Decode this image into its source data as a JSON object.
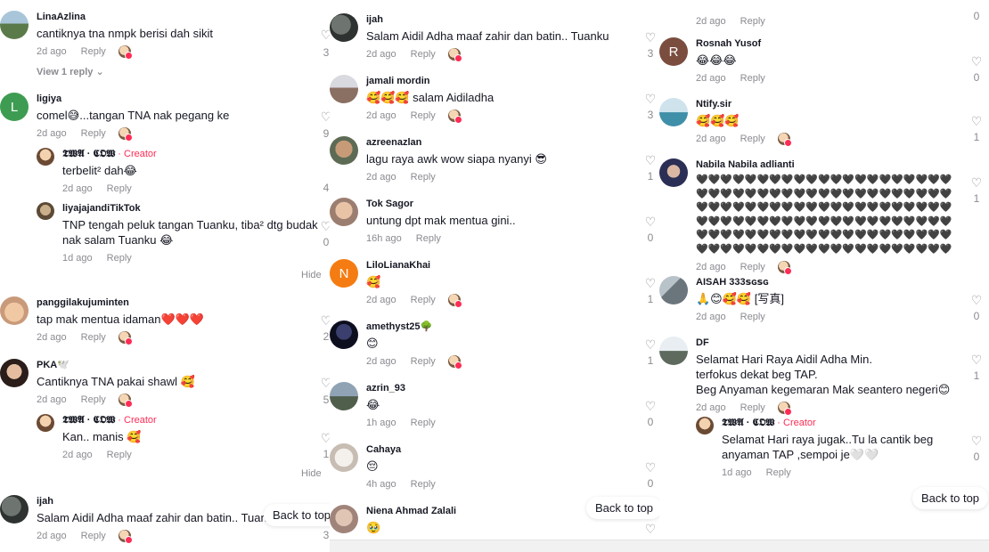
{
  "ui": {
    "reply_label": "Reply",
    "hide_label": "Hide",
    "view_reply_label": "View 1 reply",
    "back_to_top": "Back to top",
    "creator_label": "· Creator",
    "heart_icon": "heart-outline",
    "chevron_icon": "chevron-down",
    "colors": {
      "creator": "#fe2c55",
      "meta": "#8a8b91",
      "text": "#161823"
    }
  },
  "col1": {
    "c1": {
      "user": "LinaAzlina",
      "text": "cantiknya tna nmpk berisi dah sikit",
      "time": "2d ago",
      "likes": "3"
    },
    "c2": {
      "user": "ligiya",
      "avatar_letter": "L",
      "text": "comel😅...tangan TNA nak pegang ke",
      "time": "2d ago",
      "likes": "9"
    },
    "r2a": {
      "user": "𝕿𝖂𝕬 · 𝕮𝕺𝖂",
      "text": "terbelit² dah😂",
      "time": "2d ago"
    },
    "r2b": {
      "user": "liyajajandiTikTok",
      "text": "TNP tengah peluk tangan Tuanku, tiba² dtg budak nak salam Tuanku 😂",
      "time": "1d ago",
      "likes": "4",
      "likes2": "0"
    },
    "c3": {
      "user": "panggilakujuminten",
      "text": "tap mak mentua idaman❤️❤️❤️",
      "time": "2d ago",
      "likes": "2"
    },
    "c4": {
      "user": "PKA🕊️",
      "text": "Cantiknya TNA pakai shawl 🥰",
      "time": "2d ago",
      "likes": "5"
    },
    "r4a": {
      "user": "𝕿𝖂𝕬 · 𝕮𝕺𝖂",
      "text": "Kan.. manis 🥰",
      "time": "2d ago",
      "likes": "1"
    },
    "c5": {
      "user": "ijah",
      "text": "Salam Aidil Adha maaf zahir dan batin.. Tuanku",
      "time": "2d ago",
      "likes": "3"
    }
  },
  "col2": {
    "c1": {
      "user": "ijah",
      "text": "Salam Aidil Adha maaf zahir dan batin.. Tuanku",
      "time": "2d ago",
      "likes": "3"
    },
    "c2": {
      "user": "jamali mordin",
      "text": "🥰🥰🥰 salam Aidiladha",
      "time": "2d ago",
      "likes": "3"
    },
    "c3": {
      "user": "azreenazlan",
      "text": "lagu raya awk wow siapa nyanyi 😎",
      "time": "2d ago",
      "likes": "1"
    },
    "c4": {
      "user": "Tok Sagor",
      "text": "untung dpt mak mentua gini..",
      "time": "16h ago",
      "likes": "0"
    },
    "c5": {
      "user": "LiloLianaKhai",
      "avatar_letter": "N",
      "text": "🥰",
      "time": "2d ago",
      "likes": "1"
    },
    "c6": {
      "user": "amethyst25🌳",
      "text": "😊",
      "time": "2d ago",
      "likes": "1"
    },
    "c7": {
      "user": "azrin_93",
      "text": "😂",
      "time": "1h ago",
      "likes": "0"
    },
    "c8": {
      "user": "Cahaya",
      "text": "😔",
      "time": "4h ago",
      "likes": "0"
    },
    "c9": {
      "user": "Niena Ahmad Zalali",
      "text": "🥹"
    }
  },
  "col3": {
    "c0": {
      "time": "2d ago",
      "likes": "0"
    },
    "c1": {
      "user": "Rosnah Yusof",
      "avatar_letter": "R",
      "text": "😂😂😂",
      "time": "2d ago",
      "likes": "0"
    },
    "c2": {
      "user": "Ntify.sir",
      "text": "🥰🥰🥰",
      "time": "2d ago",
      "likes": "1"
    },
    "c3": {
      "user": "Nabila Nabila adlianti",
      "text": "🖤🖤🖤🖤🖤🖤🖤🖤🖤🖤🖤🖤🖤🖤🖤🖤🖤🖤🖤🖤🖤🖤🖤🖤🖤🖤🖤🖤🖤🖤🖤🖤🖤🖤🖤🖤🖤🖤🖤🖤🖤🖤🖤🖤🖤🖤🖤🖤🖤🖤🖤🖤🖤🖤🖤🖤🖤🖤🖤🖤🖤🖤🖤🖤🖤🖤🖤🖤🖤🖤🖤🖤🖤🖤🖤🖤🖤🖤🖤🖤🖤🖤🖤🖤🖤🖤🖤🖤🖤🖤🖤🖤🖤🖤🖤🖤🖤🖤🖤🖤🖤🖤🖤🖤🖤🖤🖤🖤🖤🖤🖤🖤🖤🖤🖤🖤🖤🖤🖤🖤🖤🖤🖤🖤🖤🖤",
      "time": "2d ago",
      "likes": "1"
    },
    "c4": {
      "user": "AISAH 333ꜱɢꜱɢ",
      "text": "🙏😊🥰🥰 [写真]",
      "time": "2d ago",
      "likes": "0"
    },
    "c5": {
      "user": "DF",
      "text1": "Selamat Hari Raya Aidil Adha Min.",
      "text2": "terfokus dekat beg TAP.",
      "text3": "Beg Anyaman kegemaran Mak seantero negeri😊",
      "time": "2d ago",
      "likes": "1"
    },
    "r5a": {
      "user": "𝕿𝖂𝕬 · 𝕮𝕺𝖂",
      "text": "Selamat Hari raya jugak..Tu la cantik beg anyaman TAP ,sempoi je🤍🤍",
      "time": "1d ago",
      "likes": "0"
    }
  }
}
